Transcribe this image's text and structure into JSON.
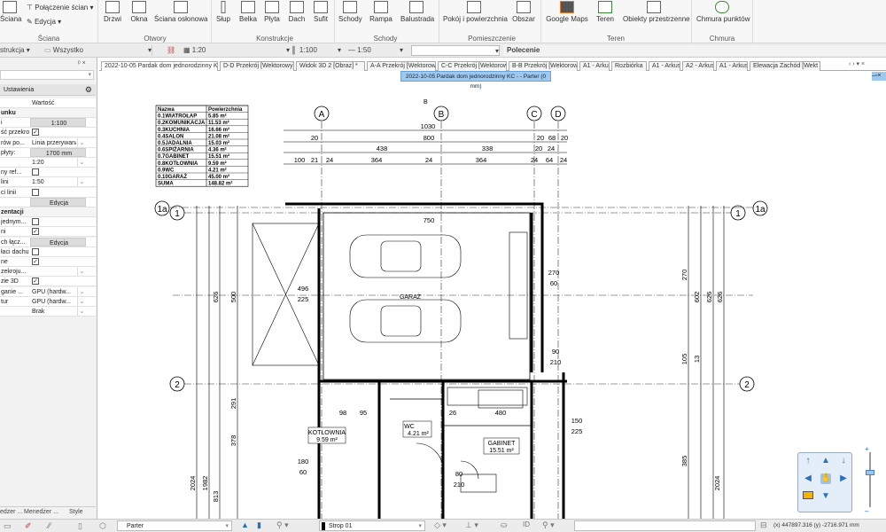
{
  "ribbon": {
    "items": [
      {
        "label": "Ściana",
        "icon": "wall-icon"
      },
      {
        "label": "Połączenie ścian",
        "icon": "wall-join-icon"
      },
      {
        "label": "Edycja",
        "icon": "edit-icon"
      },
      {
        "label": "Drzwi",
        "icon": "door-icon"
      },
      {
        "label": "Okna",
        "icon": "window-icon"
      },
      {
        "label": "Ściana osłonowa",
        "icon": "curtain-wall-icon"
      },
      {
        "label": "Słup",
        "icon": "column-icon"
      },
      {
        "label": "Belka",
        "icon": "beam-icon"
      },
      {
        "label": "Płyta",
        "icon": "slab-icon"
      },
      {
        "label": "Dach",
        "icon": "roof-icon"
      },
      {
        "label": "Sufit",
        "icon": "ceiling-icon"
      },
      {
        "label": "Schody",
        "icon": "stairs-icon"
      },
      {
        "label": "Rampa",
        "icon": "ramp-icon"
      },
      {
        "label": "Balustrada",
        "icon": "railing-icon"
      },
      {
        "label": "Pokój i powierzchnia",
        "icon": "room-icon"
      },
      {
        "label": "Obszar",
        "icon": "area-icon"
      },
      {
        "label": "Google Maps",
        "icon": "google-maps-icon"
      },
      {
        "label": "Teren",
        "icon": "terrain-icon"
      },
      {
        "label": "Obiekty przestrzenne",
        "icon": "spatial-objects-icon"
      },
      {
        "label": "Chmura punktów",
        "icon": "point-cloud-icon"
      }
    ],
    "groups": [
      "Ściana",
      "Otwory",
      "Konstrukcje",
      "Schody",
      "Pomieszczenie",
      "Teren",
      "Chmura punktów"
    ]
  },
  "toolbar": {
    "construction": "strukcja",
    "layer_filter": "Wszystko",
    "scale1": "1:20",
    "scale2": "1:100",
    "scale3": "1:50",
    "command_label": "Polecenie"
  },
  "left_panel": {
    "header_title": "Ustawienia",
    "value_col": "Wartość",
    "rows": [
      {
        "label": "unku",
        "section": true
      },
      {
        "label": "i",
        "value": "1:100",
        "type": "button"
      },
      {
        "label": "ść przekroju",
        "checked": true,
        "type": "check"
      },
      {
        "label": "rów po...",
        "value": "Linia przerywana",
        "type": "select"
      },
      {
        "label": " płyty:",
        "value": "1700 mm",
        "type": "button"
      },
      {
        "label": "",
        "value": "1:20",
        "type": "select"
      },
      {
        "label": "ny ref...",
        "checked": false,
        "type": "check"
      },
      {
        "label": "lini",
        "value": "1:50",
        "type": "select"
      },
      {
        "label": "ci linii",
        "checked": false,
        "type": "check"
      },
      {
        "label": "",
        "value": "Edycja",
        "type": "button"
      },
      {
        "label": "zentacji",
        "section": true
      },
      {
        "label": "jednym...",
        "checked": false,
        "type": "check"
      },
      {
        "label": "ni",
        "checked": true,
        "type": "check"
      },
      {
        "label": "ch łącz...",
        "value": "Edycja",
        "type": "button"
      },
      {
        "label": "łaci dachu",
        "checked": false,
        "type": "check"
      },
      {
        "label": "ne",
        "checked": true,
        "type": "check"
      },
      {
        "label": "zekroju...",
        "value": "",
        "type": "select"
      },
      {
        "label": "zie 3D",
        "checked": true,
        "type": "check"
      },
      {
        "label": "ganie ...",
        "value": "GPU (hardw...",
        "type": "select"
      },
      {
        "label": "tur",
        "value": "GPU (hardw...",
        "type": "select"
      },
      {
        "label": "",
        "value": "Brak",
        "type": "select"
      }
    ],
    "bottom_tabs": [
      "edzer ...",
      "Menedżer ...",
      "Style"
    ]
  },
  "tabs": [
    "2022-10-05 Pardak dom jednorodzinny KC",
    "D-D Przekrój [Wektorowy]",
    "Widok 3D 2 [Obraz] *",
    "A-A Przekrój [Wektorowy]",
    "C-C Przekrój [Wektorowy]",
    "B-B Przekrój [Wektorowy]",
    "A1 - Arkusz",
    "Rozbiórka",
    "A1 - Arkusz",
    "A2 - Arkusz",
    "A1 - Arkusz",
    "Elewacja Zachód [Wekt"
  ],
  "view_title": "2022-10-05 Pardak dom jednorodzinny KC -  - Parter (0 mm)",
  "area_table": {
    "headers": [
      "Nazwa",
      "Powierzchnia"
    ],
    "rows": [
      [
        "0.1WIATROŁAP",
        "5.85 m²"
      ],
      [
        "0.2KOMUNIKACJA",
        "11.53 m²"
      ],
      [
        "0.3KUCHNIA",
        "16.66 m²"
      ],
      [
        "0.4SALON",
        "21.08 m²"
      ],
      [
        "0.5JADALNIA",
        "15.03 m²"
      ],
      [
        "0.6SPIŻARNIA",
        "4.36 m²"
      ],
      [
        "0.7GABINET",
        "15.51 m²"
      ],
      [
        "0.8KOTŁOWNIA",
        "9.59 m²"
      ],
      [
        "0.9WC",
        "4.21 m²"
      ],
      [
        "0.10GARAŻ",
        "45.00 m²"
      ]
    ],
    "total": [
      "SUMA",
      "148.82 m²"
    ]
  },
  "plan": {
    "axes": [
      "A",
      "B",
      "C",
      "D",
      "1a",
      "1",
      "1",
      "1a",
      "2",
      "2"
    ],
    "dims": [
      "1030",
      "20",
      "800",
      "20",
      "68",
      "20",
      "438",
      "338",
      "20",
      "24",
      "100",
      "21",
      "24",
      "364",
      "24",
      "364",
      "24",
      "64",
      "24",
      "750",
      "496",
      "225",
      "270",
      "60",
      "90",
      "210",
      "150",
      "225",
      "180",
      "60",
      "80",
      "210",
      "98",
      "95",
      "26",
      "480",
      "2024",
      "1982",
      "626",
      "500",
      "291",
      "378",
      "813",
      "270",
      "602",
      "626",
      "626",
      "385",
      "2024",
      "105",
      "13"
    ],
    "rooms": [
      {
        "name": "GARAŻ"
      },
      {
        "name": "KOTŁOWNIA",
        "area": "9.59 m²"
      },
      {
        "name": "WC",
        "area": "4.21 m²"
      },
      {
        "name": "GABINET",
        "area": "15.51 m²"
      }
    ],
    "section_marker": "B"
  },
  "status": {
    "floor": "Parter",
    "slab": "Strop 01",
    "coords": "(x) 447897.316   (y) -2716.971 mm"
  }
}
